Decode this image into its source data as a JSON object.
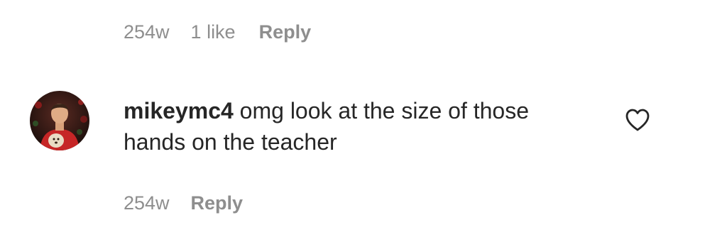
{
  "previous_comment": {
    "timestamp": "254w",
    "likes": "1 like",
    "reply_label": "Reply"
  },
  "comment": {
    "avatar_icon": "profile-photo-avatar",
    "username": "mikeymc4",
    "text": "omg look at the size of those hands on the teacher",
    "timestamp": "254w",
    "reply_label": "Reply",
    "like_icon": "heart-outline-icon"
  },
  "colors": {
    "text_primary": "#262626",
    "text_secondary": "#8e8e8e",
    "background": "#ffffff"
  }
}
